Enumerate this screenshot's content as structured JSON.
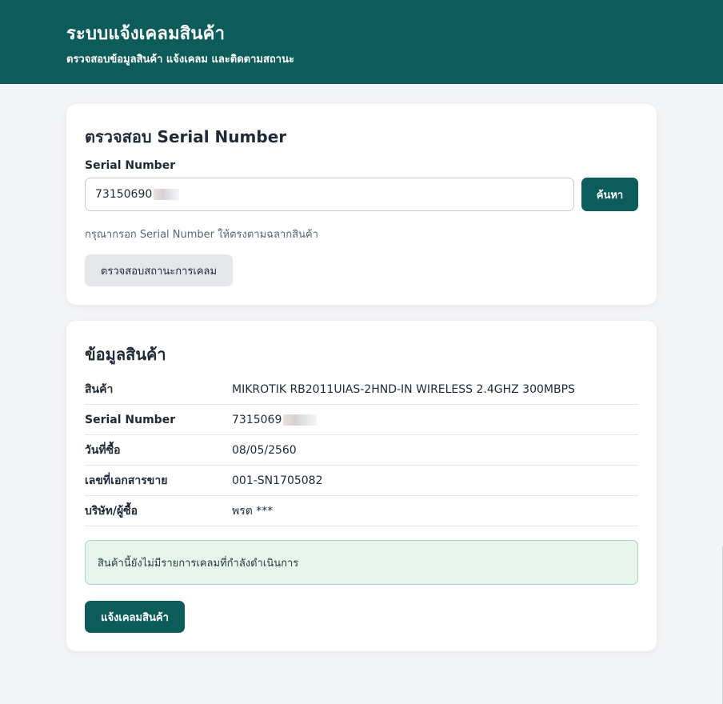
{
  "header": {
    "title": "ระบบแจ้งเคลมสินค้า",
    "subtitle": "ตรวจสอบข้อมูลสินค้า แจ้งเคลม และติดตามสถานะ"
  },
  "search_card": {
    "title": "ตรวจสอบ Serial Number",
    "field_label": "Serial Number",
    "input_value": "73150690",
    "search_button": "ค้นหา",
    "hint": "กรุณากรอก Serial Number ให้ตรงตามฉลากสินค้า",
    "claim_status_button": "ตรวจสอบสถานะการเคลม"
  },
  "info_card": {
    "title": "ข้อมูลสินค้า",
    "rows": [
      {
        "label": "สินค้า",
        "value": "MIKROTIK RB2011UIAS-2HND-IN WIRELESS 2.4GHZ 300MBPS"
      },
      {
        "label": "Serial Number",
        "value": "7315069"
      },
      {
        "label": "วันที่ซื้อ",
        "value": "08/05/2560"
      },
      {
        "label": "เลขที่เอกสารขาย",
        "value": "001-SN1705082"
      },
      {
        "label": "บริษัท/ผู้ซื้อ",
        "value": "พรต ***"
      }
    ],
    "notice": "สินค้านี้ยังไม่มีรายการเคลมที่กำลังดำเนินการ",
    "claim_button": "แจ้งเคลมสินค้า"
  },
  "colors": {
    "brand": "#0d5c5c",
    "background": "#f3f4f6",
    "notice_bg": "#e8f5ee"
  }
}
